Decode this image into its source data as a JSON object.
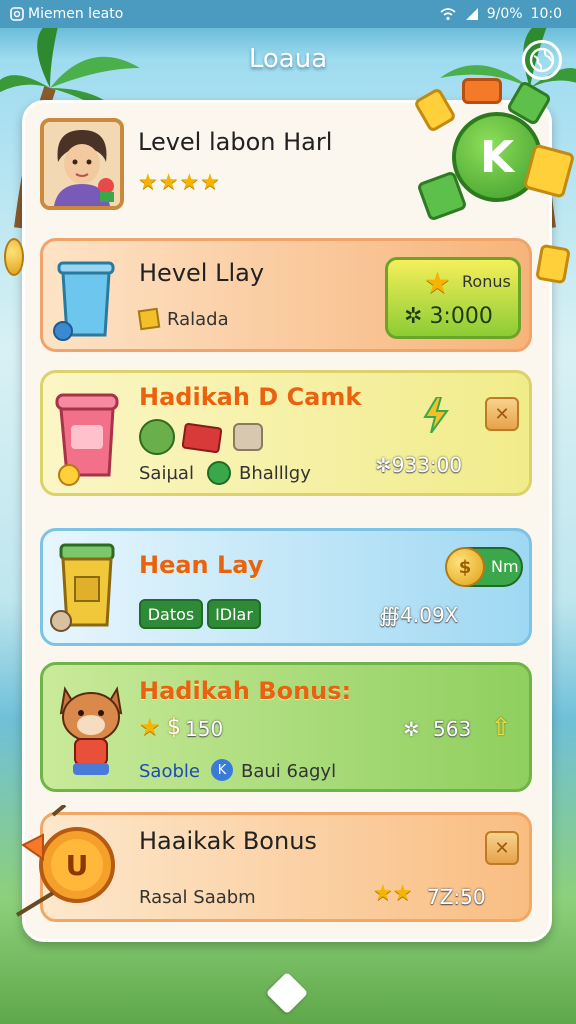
{
  "status_bar": {
    "app_label": "Miemen leato",
    "battery": "9/0%",
    "time": "10:0"
  },
  "header": {
    "title": "Loaua"
  },
  "profile": {
    "name": "Level labon Harl",
    "stars": "★★★★"
  },
  "cards": [
    {
      "title": "Hevel Llay",
      "subtitle": "Ralada",
      "bonus_label": "Ronus",
      "bonus_value": "3:000"
    },
    {
      "title": "Hadikah D Camk",
      "sub_left": "Saiµal",
      "sub_right": "Bhalllgy",
      "value": "✲933:00"
    },
    {
      "title": "Hean Lay",
      "pill_1": "Datos",
      "pill_2": "IDlar",
      "badge": "Nm",
      "value": "∰4.09X"
    },
    {
      "title": "Hadikah Bonus:",
      "coins": "150",
      "sub_left": "Saoble",
      "sub_right": "Baui 6agyl",
      "value": "563"
    },
    {
      "title": "Haaikak Bonus",
      "subtitle": "Rasal Saabm",
      "value": "7Z:50"
    }
  ],
  "colors": {
    "accent_orange": "#e8620f",
    "accent_green": "#2f8a38",
    "panel": "#fbf7ee"
  }
}
